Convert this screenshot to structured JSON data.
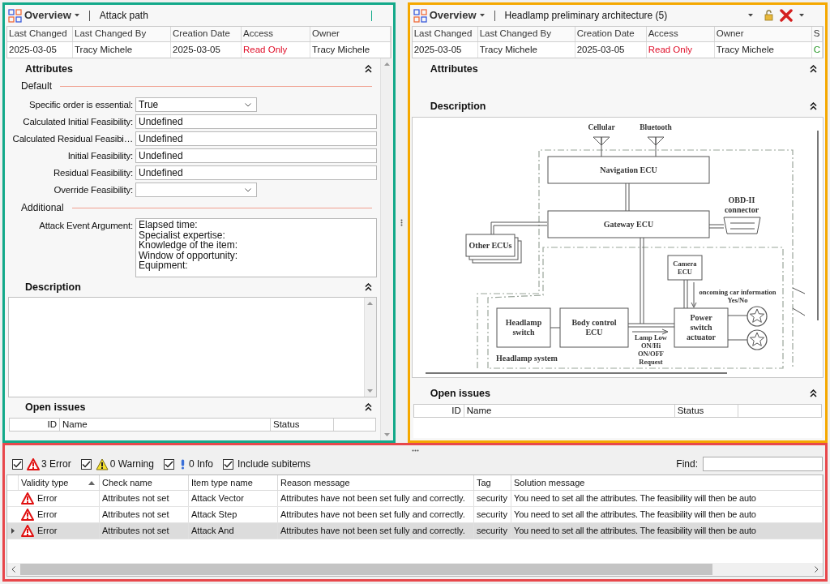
{
  "left_pane": {
    "view": "Overview",
    "title": "Attack path",
    "meta": {
      "columns": [
        "Last Changed",
        "Last Changed By",
        "Creation Date",
        "Access",
        "Owner"
      ],
      "row": [
        {
          "text": "2025-03-05",
          "kind": "plain"
        },
        {
          "text": "Tracy Michele",
          "kind": "plain"
        },
        {
          "text": "2025-03-05",
          "kind": "plain"
        },
        {
          "text": "Read Only",
          "kind": "alert"
        },
        {
          "text": "Tracy Michele",
          "kind": "plain"
        }
      ]
    },
    "attributes": {
      "title": "Attributes",
      "groups": [
        {
          "title": "Default",
          "fields": [
            {
              "label": "Specific order is essential:",
              "kind": "dropdown",
              "value": "True"
            },
            {
              "label": "Calculated Initial Feasibility:",
              "kind": "text",
              "value": "Undefined"
            },
            {
              "label": "Calculated Residual Feasibi…",
              "kind": "text",
              "value": "Undefined"
            },
            {
              "label": "Initial Feasibility:",
              "kind": "text",
              "value": "Undefined"
            },
            {
              "label": "Residual Feasibility:",
              "kind": "text",
              "value": "Undefined"
            },
            {
              "label": "Override Feasibility:",
              "kind": "dropdown"
            }
          ]
        },
        {
          "title": "Additional",
          "fields": [
            {
              "label": "Attack Event Argument:",
              "kind": "textarea",
              "lines": [
                "Elapsed time:",
                "Specialist expertise:",
                "Knowledge of the item:",
                "Window of opportunity:",
                "Equipment:"
              ]
            }
          ]
        }
      ]
    },
    "description": {
      "title": "Description"
    },
    "open_issues": {
      "title": "Open issues",
      "columns": [
        "ID",
        "Name",
        "Status"
      ]
    }
  },
  "right_pane": {
    "view": "Overview",
    "title": "Headlamp preliminary architecture (5)",
    "meta": {
      "columns": [
        "Last Changed",
        "Last Changed By",
        "Creation Date",
        "Access",
        "Owner",
        "S"
      ],
      "row": [
        {
          "text": "2025-03-05",
          "kind": "plain"
        },
        {
          "text": "Tracy Michele",
          "kind": "plain"
        },
        {
          "text": "2025-03-05",
          "kind": "plain"
        },
        {
          "text": "Read Only",
          "kind": "alert"
        },
        {
          "text": "Tracy Michele",
          "kind": "plain"
        },
        {
          "text": "C",
          "kind": "ok"
        }
      ]
    },
    "attributes": {
      "title": "Attributes"
    },
    "description": {
      "title": "Description",
      "diagram": {
        "blocks": [
          {
            "lines": [
              "Navigation ECU"
            ]
          },
          {
            "lines": [
              "Gateway ECU"
            ]
          },
          {
            "lines": [
              "Other ECUs"
            ]
          },
          {
            "lines": [
              "Camera",
              "ECU"
            ]
          },
          {
            "lines": [
              "Headlamp",
              "switch"
            ]
          },
          {
            "lines": [
              "Body control",
              "ECU"
            ]
          },
          {
            "lines": [
              "Power",
              "switch",
              "actuator"
            ]
          }
        ],
        "labels": [
          {
            "lines": [
              "Cellular"
            ]
          },
          {
            "lines": [
              "Bluetooth"
            ]
          },
          {
            "lines": [
              "OBD-II",
              "connector"
            ]
          },
          {
            "lines": [
              "oncoming car information",
              "Yes/No"
            ]
          },
          {
            "lines": [
              "Headlamp system"
            ]
          },
          {
            "lines": [
              "Lamp Low",
              "ON/Hi",
              "ON/OFF",
              "Request"
            ]
          }
        ]
      }
    },
    "open_issues": {
      "title": "Open issues",
      "columns": [
        "ID",
        "Name",
        "Status"
      ]
    }
  },
  "validation": {
    "filters": [
      {
        "label": "3 Error",
        "kind": "error",
        "checked": true
      },
      {
        "label": "0 Warning",
        "kind": "warning",
        "checked": true
      },
      {
        "label": "0 Info",
        "kind": "info",
        "checked": true
      },
      {
        "label": "Include subitems",
        "kind": "plain",
        "checked": true
      }
    ],
    "find_label": "Find:",
    "columns": [
      {
        "label": "Validity type",
        "sorted": true
      },
      {
        "label": "Check name",
        "sorted": false
      },
      {
        "label": "Item type name",
        "sorted": false
      },
      {
        "label": "Reason message",
        "sorted": false
      },
      {
        "label": "Tag",
        "sorted": false
      },
      {
        "label": "Solution message",
        "sorted": false
      }
    ],
    "rows": [
      {
        "kind": "error",
        "selected": false,
        "cells": [
          "Error",
          "Attributes not set",
          "Attack Vector",
          "Attributes have not been set fully and correctly.",
          "security",
          "You need to set all the attributes. The feasibility will then be auto"
        ]
      },
      {
        "kind": "error",
        "selected": false,
        "cells": [
          "Error",
          "Attributes not set",
          "Attack Step",
          "Attributes have not been set fully and correctly.",
          "security",
          "You need to set all the attributes. The feasibility will then be auto"
        ]
      },
      {
        "kind": "error",
        "selected": true,
        "cells": [
          "Error",
          "Attributes not set",
          "Attack And",
          "Attributes have not been set fully and correctly.",
          "security",
          "You need to set all the attributes. The feasibility will then be auto"
        ]
      }
    ]
  }
}
